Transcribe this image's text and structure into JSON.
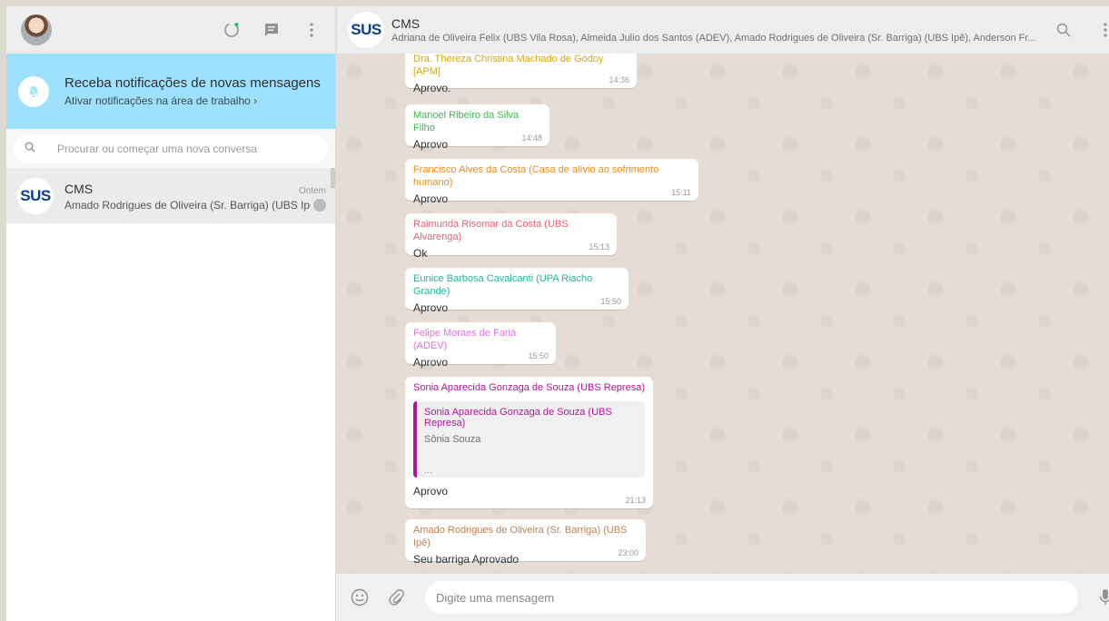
{
  "sidebar": {
    "notification": {
      "title": "Receba notificações de novas mensagens",
      "subtitle": "Ativar notificações na área de trabalho ›"
    },
    "search": {
      "placeholder": "Procurar ou começar uma nova conversa"
    },
    "chats": [
      {
        "logo": "SUS",
        "name": "CMS",
        "time": "Ontem",
        "last_message": "Amado Rodrigues de Oliveira (Sr. Barriga) (UBS Ipê"
      }
    ]
  },
  "conversation": {
    "logo": "SUS",
    "title": "CMS",
    "members": "Adriana de Oliveira Felix (UBS Vila Rosa), Almeida Julio dos Santos (ADEV), Amado Rodrigues de Oliveira (Sr. Barriga) (UBS Ipê), Anderson Fr...",
    "messages": [
      {
        "sender": "Dra. Thereza Christina Machado de Godoy [APM]",
        "text": "Aprovo.",
        "time": "14:36",
        "color": "#d4a80d"
      },
      {
        "sender": "Manoel Ribeiro da Silva Filho",
        "text": "Aprovo",
        "time": "14:48",
        "color": "#35c04a"
      },
      {
        "sender": "Francisco Alves da Costa (Casa de alívio ao sofrimento humano)",
        "text": "Aprovo",
        "time": "15:11",
        "color": "#f28a10"
      },
      {
        "sender": "Raimunda Risomar da Costa (UBS Alvarenga)",
        "text": "Ok",
        "time": "15:13",
        "color": "#f05a70"
      },
      {
        "sender": "Eunice Barbosa Cavalcanti (UPA Riacho Grande)",
        "text": "Aprovo",
        "time": "15:50",
        "color": "#1fb59b"
      },
      {
        "sender": "Felipe Moraes de Faria (ADEV)",
        "text": "Aprovo",
        "time": "15:50",
        "color": "#e66ee0"
      },
      {
        "sender": "Sonia Aparecida Gonzaga de Souza (UBS Represa)",
        "text": "Aprovo",
        "time": "21:13",
        "color": "#b0129c",
        "quote": {
          "sender": "Sonia Aparecida Gonzaga de Souza (UBS Represa)",
          "text": "Sônia Souza",
          "more": "..."
        }
      },
      {
        "sender": "Amado Rodrigues de Oliveira (Sr. Barriga) (UBS Ipê)",
        "text": "Seu barriga Aprovado",
        "time": "23:00",
        "color": "#c08050"
      }
    ]
  },
  "composer": {
    "placeholder": "Digite uma mensagem"
  },
  "icons": {
    "status": "status-icon",
    "new_chat": "new-chat-icon",
    "menu": "menu-icon",
    "bell_off": "bell-off-icon",
    "search": "search-icon",
    "emoji": "emoji-icon",
    "attach": "attach-icon",
    "mic": "mic-icon"
  }
}
